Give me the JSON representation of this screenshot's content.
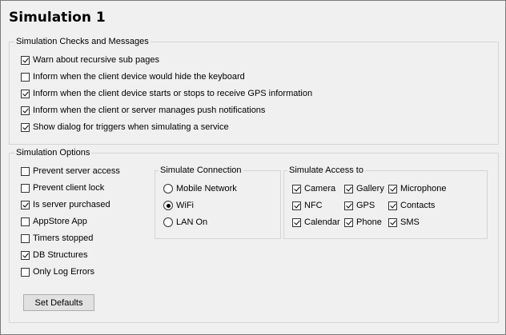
{
  "title": "Simulation 1",
  "checks_group": {
    "label": "Simulation Checks and Messages",
    "items": [
      {
        "label": "Warn about recursive sub pages",
        "checked": true
      },
      {
        "label": "Inform when the client device would hide the keyboard",
        "checked": false
      },
      {
        "label": "Inform when the client device starts or stops to receive GPS information",
        "checked": true
      },
      {
        "label": "Inform when the client or server manages push notifications",
        "checked": true
      },
      {
        "label": "Show dialog for triggers when simulating a service",
        "checked": true
      }
    ]
  },
  "options_group": {
    "label": "Simulation Options",
    "items": [
      {
        "label": "Prevent server access",
        "checked": false
      },
      {
        "label": "Prevent client lock",
        "checked": false
      },
      {
        "label": "Is server purchased",
        "checked": true
      },
      {
        "label": "AppStore App",
        "checked": false
      },
      {
        "label": "Timers stopped",
        "checked": false
      },
      {
        "label": "DB Structures",
        "checked": true
      },
      {
        "label": "Only Log Errors",
        "checked": false
      }
    ],
    "set_defaults_label": "Set Defaults"
  },
  "connection_group": {
    "label": "Simulate Connection",
    "options": [
      "Mobile Network",
      "WiFi",
      "LAN On"
    ],
    "selected": "WiFi"
  },
  "access_group": {
    "label": "Simulate Access to",
    "items": [
      {
        "label": "Camera",
        "checked": true
      },
      {
        "label": "Gallery",
        "checked": true
      },
      {
        "label": "Microphone",
        "checked": true
      },
      {
        "label": "NFC",
        "checked": true
      },
      {
        "label": "GPS",
        "checked": true
      },
      {
        "label": "Contacts",
        "checked": true
      },
      {
        "label": "Calendar",
        "checked": true
      },
      {
        "label": "Phone",
        "checked": true
      },
      {
        "label": "SMS",
        "checked": true
      }
    ]
  }
}
